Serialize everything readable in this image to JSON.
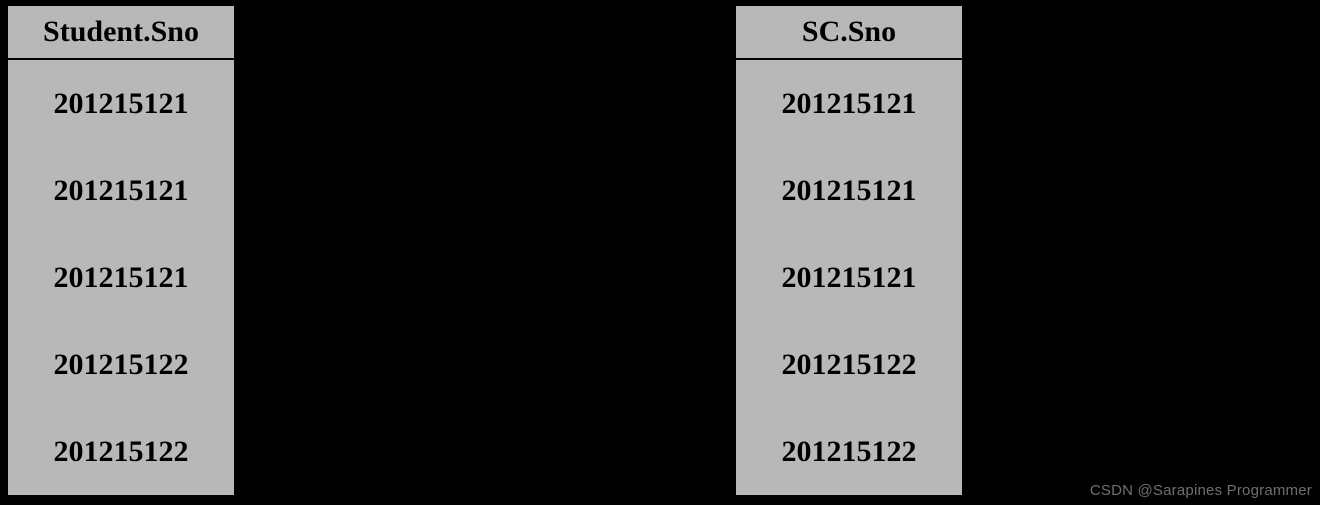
{
  "tables": {
    "left": {
      "header": "Student.Sno",
      "rows": [
        "201215121",
        "201215121",
        "201215121",
        "201215122",
        "201215122"
      ]
    },
    "right": {
      "header": "SC.Sno",
      "rows": [
        "201215121",
        "201215121",
        "201215121",
        "201215122",
        "201215122"
      ]
    }
  },
  "watermark": "CSDN @Sarapines Programmer",
  "chart_data": {
    "type": "table",
    "description": "Two database relation columns side by side showing join result on Sno attribute",
    "tables": [
      {
        "name": "Student.Sno",
        "column_header": "Student.Sno",
        "values": [
          "201215121",
          "201215121",
          "201215121",
          "201215122",
          "201215122"
        ]
      },
      {
        "name": "SC.Sno",
        "column_header": "SC.Sno",
        "values": [
          "201215121",
          "201215121",
          "201215121",
          "201215122",
          "201215122"
        ]
      }
    ]
  }
}
